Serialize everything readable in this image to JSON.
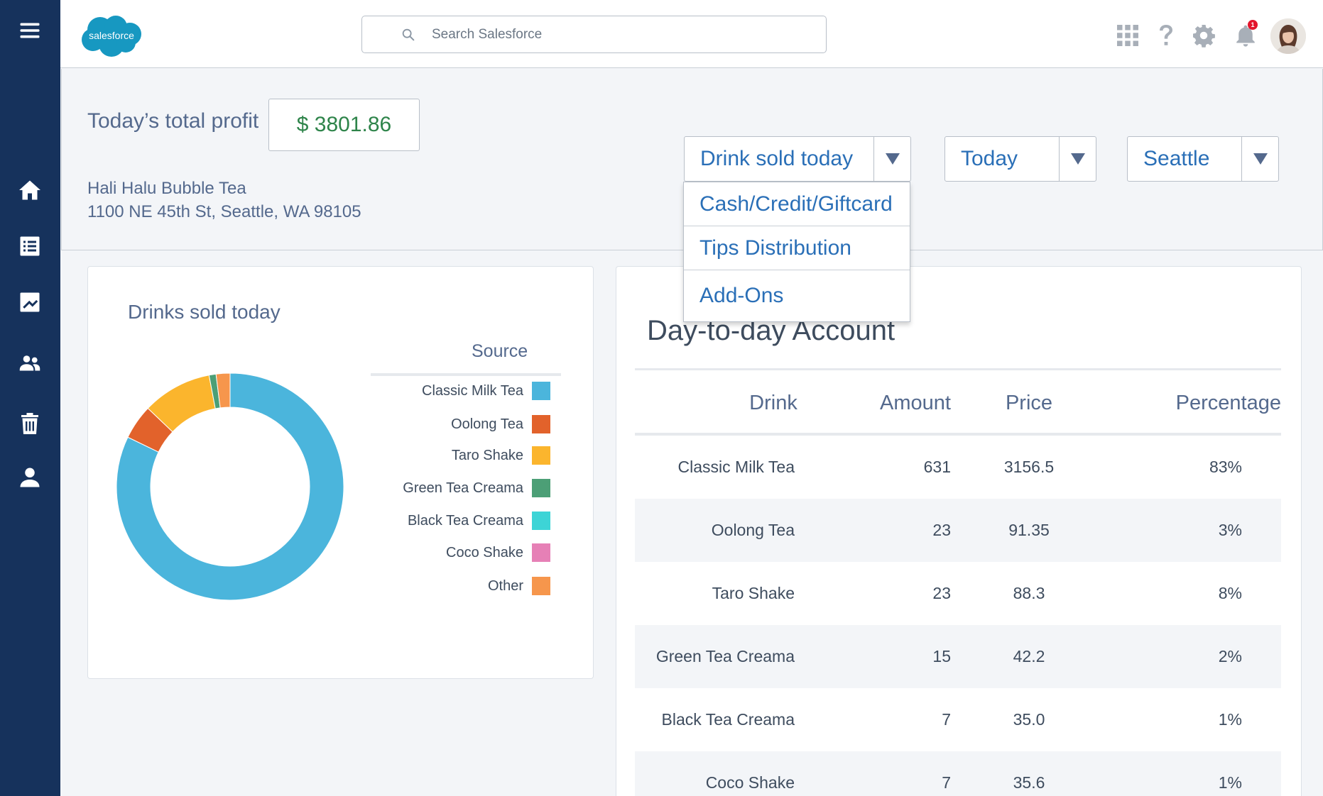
{
  "app": {
    "logo_text": "salesforce"
  },
  "search": {
    "placeholder": "Search Salesforce"
  },
  "notifications": {
    "count": "1"
  },
  "header": {
    "profit_label": "Today’s total profit",
    "profit_value": "$ 3801.86",
    "store_name": "Hali Halu Bubble Tea",
    "store_address": "1100 NE 45th St, Seattle, WA 98105"
  },
  "filters": {
    "report": "Drink sold today",
    "period": "Today",
    "location": "Seattle"
  },
  "report_menu": {
    "items": [
      "Cash/Credit/Giftcard",
      "Tips Distribution",
      "Add-Ons"
    ]
  },
  "chart_data": {
    "type": "pie",
    "title": "Drinks sold today",
    "legend_title": "Source",
    "legend_position": "right",
    "categories": [
      "Classic Milk Tea",
      "Oolong Tea",
      "Taro Shake",
      "Green Tea Creama",
      "Black Tea Creama",
      "Coco Shake",
      "Other"
    ],
    "values": [
      83,
      5,
      10,
      1,
      0,
      0,
      2
    ],
    "colors": [
      "#4bb5dc",
      "#e2622b",
      "#fbb52d",
      "#4c9f76",
      "#3dd4d6",
      "#e680b6",
      "#f6964c"
    ]
  },
  "account": {
    "title": "Day-to-day Account",
    "columns": [
      "Drink",
      "Amount",
      "Price",
      "Percentage"
    ],
    "rows": [
      [
        "Classic Milk Tea",
        "631",
        "3156.5",
        "83%"
      ],
      [
        "Oolong Tea",
        "23",
        "91.35",
        "3%"
      ],
      [
        "Taro Shake",
        "23",
        "88.3",
        "8%"
      ],
      [
        "Green Tea Creama",
        "15",
        "42.2",
        "2%"
      ],
      [
        "Black Tea Creama",
        "7",
        "35.0",
        "1%"
      ],
      [
        "Coco Shake",
        "7",
        "35.6",
        "1%"
      ]
    ]
  }
}
